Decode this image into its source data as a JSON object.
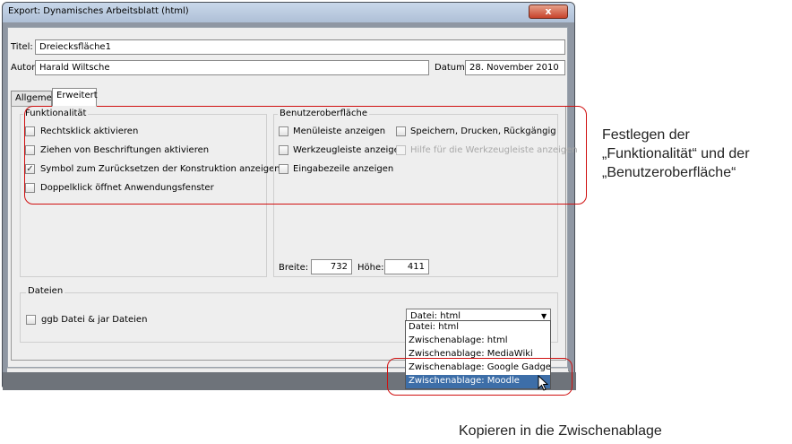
{
  "window": {
    "title": "Export: Dynamisches Arbeitsblatt (html)",
    "close_glyph": "x"
  },
  "form": {
    "title_label": "Titel:",
    "title_value": "Dreiecksfläche1",
    "author_label": "Autor:",
    "author_value": "Harald Wiltsche",
    "date_label": "Datum:",
    "date_value": "28. November 2010"
  },
  "tabs": [
    "Allgemein",
    "Erweitert"
  ],
  "functionality": {
    "title": "Funktionalität",
    "options": [
      {
        "label": "Rechtsklick aktivieren",
        "checked": false
      },
      {
        "label": "Ziehen von Beschriftungen aktivieren",
        "checked": false
      },
      {
        "label": "Symbol zum Zurücksetzen der Konstruktion anzeigen",
        "checked": true
      },
      {
        "label": "Doppelklick öffnet Anwendungsfenster",
        "checked": false
      }
    ]
  },
  "ui": {
    "title": "Benutzeroberfläche",
    "options": [
      {
        "label": "Menüleiste anzeigen",
        "checked": false,
        "enabled": true
      },
      {
        "label": "Speichern, Drucken, Rückgängig",
        "checked": false,
        "enabled": true
      },
      {
        "label": "Werkzeugleiste anzeigen",
        "checked": false,
        "enabled": true
      },
      {
        "label": "Hilfe für die Werkzeugleiste anzeigen",
        "checked": false,
        "enabled": false
      },
      {
        "label": "Eingabezeile anzeigen",
        "checked": false,
        "enabled": true
      }
    ],
    "width_label": "Breite:",
    "width_value": "732",
    "height_label": "Höhe:",
    "height_value": "411"
  },
  "files": {
    "title": "Dateien",
    "option_label": "ggb Datei & jar Dateien",
    "option_checked": false,
    "combo_value": "Datei: html",
    "dropdown": [
      "Datei: html",
      "Zwischenablage: html",
      "Zwischenablage: MediaWiki",
      "Zwischenablage: Google Gadget",
      "Zwischenablage: Moodle"
    ],
    "dropdown_selected": "Zwischenablage: Moodle"
  },
  "annotations": {
    "right_line1": "Festlegen der",
    "right_line2": "„Funktionalität“ und der",
    "right_line3": "„Benutzeroberfläche“",
    "bottom": "Kopieren in die Zwischenablage"
  },
  "colors": {
    "accent_red": "#d01010",
    "selection_blue": "#3d6ea8"
  }
}
